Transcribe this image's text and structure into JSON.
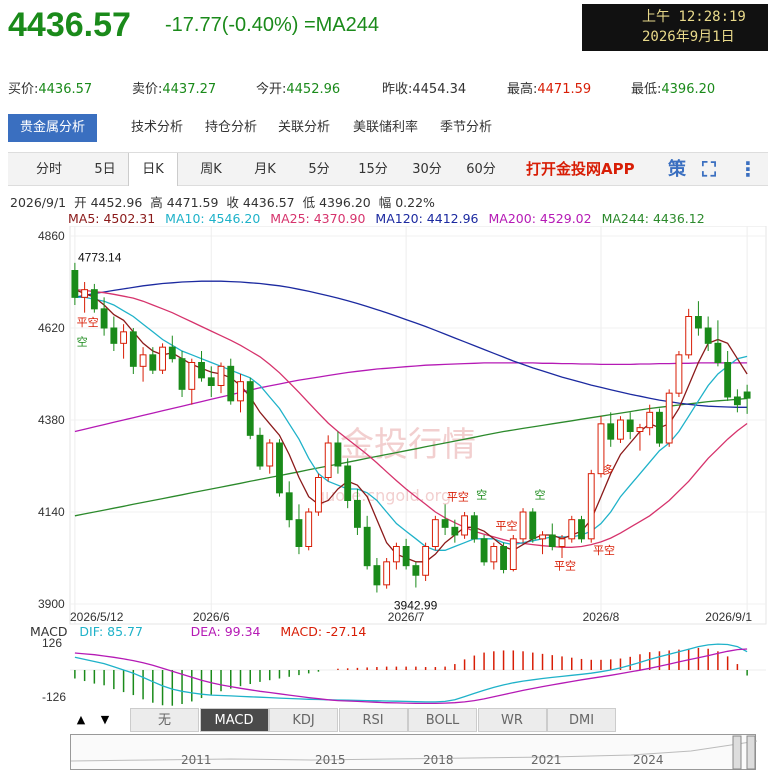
{
  "header": {
    "price": "4436.57",
    "change": "-17.77(-0.40%)",
    "indicator": "=MA244",
    "clock_line1": "上午 12:28:19",
    "clock_line2": "2026年9月1日"
  },
  "quotes": [
    {
      "label": "买价:",
      "value": "4436.57",
      "color": "g"
    },
    {
      "label": "卖价:",
      "value": "4437.27",
      "color": "g"
    },
    {
      "label": "今开:",
      "value": "4452.96",
      "color": "g"
    },
    {
      "label": "昨收:",
      "value": "4454.34",
      "color": "k"
    },
    {
      "label": "最高:",
      "value": "4471.59",
      "color": "r"
    },
    {
      "label": "最低:",
      "value": "4396.20",
      "color": "g"
    }
  ],
  "analysis_tabs": [
    "贵金属分析",
    "技术分析",
    "持仓分析",
    "关联分析",
    "美联储利率",
    "季节分析"
  ],
  "period_tabs": [
    "分时",
    "5日",
    "日K",
    "周K",
    "月K",
    "5分",
    "15分",
    "30分",
    "60分"
  ],
  "period_active": 2,
  "app_link": "打开金投网APP",
  "icons": {
    "strategy": "策",
    "fullscreen": "⛶",
    "more": "⋮"
  },
  "ohlc": {
    "date": "2026/9/1",
    "open_label": "开",
    "open": "4452.96",
    "high_label": "高",
    "high": "4471.59",
    "close_label": "收",
    "close": "4436.57",
    "low_label": "低",
    "low": "4396.20",
    "amp_label": "幅",
    "amp": "0.22%"
  },
  "ma_legend": [
    {
      "text": "MA5: 4502.31",
      "color": "#8b1a1a"
    },
    {
      "text": "MA10: 4546.20",
      "color": "#1fb2c9"
    },
    {
      "text": "MA25: 4370.90",
      "color": "#d6336c"
    },
    {
      "text": "MA120: 4412.96",
      "color": "#1c2aa0"
    },
    {
      "text": "MA200: 4529.02",
      "color": "#b51ab5"
    },
    {
      "text": "MA244: 4436.12",
      "color": "#2c8a2c"
    }
  ],
  "colors": {
    "up": "#d81e06",
    "down": "#1a8a1a",
    "accent": "#3a6fc0"
  },
  "chart_data": {
    "type": "candlestick",
    "y_ticks": [
      "4860",
      "4620",
      "4380",
      "4140",
      "3900"
    ],
    "x_ticks": [
      "2026/5/12",
      "2026/6",
      "2026/7",
      "2026/8",
      "2026/9/1"
    ],
    "ylim": [
      3900,
      4860
    ],
    "annotations": {
      "max": "4773.14",
      "min": "3942.99",
      "watermark": "金投行情",
      "watermark_url": "quote.cngold.org"
    },
    "signals": [
      "平空",
      "空",
      "平空",
      "空",
      "平空",
      "多",
      "平空",
      "空",
      "平空"
    ],
    "candles": [
      [
        4770,
        4790,
        4680,
        4700
      ],
      [
        4700,
        4740,
        4660,
        4720
      ],
      [
        4720,
        4735,
        4660,
        4670
      ],
      [
        4670,
        4700,
        4600,
        4620
      ],
      [
        4620,
        4650,
        4560,
        4580
      ],
      [
        4580,
        4630,
        4540,
        4610
      ],
      [
        4610,
        4620,
        4500,
        4520
      ],
      [
        4520,
        4570,
        4480,
        4550
      ],
      [
        4550,
        4570,
        4500,
        4510
      ],
      [
        4510,
        4580,
        4500,
        4570
      ],
      [
        4570,
        4600,
        4530,
        4540
      ],
      [
        4540,
        4560,
        4440,
        4460
      ],
      [
        4460,
        4540,
        4420,
        4530
      ],
      [
        4530,
        4560,
        4480,
        4490
      ],
      [
        4490,
        4520,
        4440,
        4470
      ],
      [
        4470,
        4530,
        4450,
        4520
      ],
      [
        4520,
        4540,
        4420,
        4430
      ],
      [
        4430,
        4500,
        4400,
        4480
      ],
      [
        4480,
        4490,
        4330,
        4340
      ],
      [
        4340,
        4360,
        4250,
        4260
      ],
      [
        4260,
        4330,
        4240,
        4320
      ],
      [
        4320,
        4330,
        4180,
        4190
      ],
      [
        4190,
        4220,
        4100,
        4120
      ],
      [
        4120,
        4160,
        4030,
        4050
      ],
      [
        4050,
        4150,
        4040,
        4140
      ],
      [
        4140,
        4240,
        4130,
        4230
      ],
      [
        4230,
        4340,
        4220,
        4320
      ],
      [
        4320,
        4350,
        4240,
        4260
      ],
      [
        4260,
        4280,
        4150,
        4170
      ],
      [
        4170,
        4200,
        4080,
        4100
      ],
      [
        4100,
        4130,
        3990,
        4000
      ],
      [
        4000,
        4020,
        3930,
        3950
      ],
      [
        3950,
        4020,
        3940,
        4010
      ],
      [
        4010,
        4060,
        3990,
        4050
      ],
      [
        4050,
        4070,
        3990,
        4000
      ],
      [
        4000,
        4010,
        3943,
        3975
      ],
      [
        3975,
        4060,
        3960,
        4050
      ],
      [
        4050,
        4130,
        4040,
        4120
      ],
      [
        4120,
        4160,
        4080,
        4100
      ],
      [
        4100,
        4120,
        4060,
        4080
      ],
      [
        4080,
        4140,
        4070,
        4130
      ],
      [
        4130,
        4140,
        4060,
        4070
      ],
      [
        4070,
        4080,
        4000,
        4010
      ],
      [
        4010,
        4060,
        3990,
        4050
      ],
      [
        4050,
        4060,
        3980,
        3990
      ],
      [
        3990,
        4080,
        3985,
        4070
      ],
      [
        4070,
        4150,
        4060,
        4140
      ],
      [
        4140,
        4150,
        4060,
        4070
      ],
      [
        4070,
        4090,
        4030,
        4080
      ],
      [
        4080,
        4110,
        4040,
        4050
      ],
      [
        4050,
        4080,
        4020,
        4070
      ],
      [
        4070,
        4130,
        4060,
        4120
      ],
      [
        4120,
        4130,
        4060,
        4070
      ],
      [
        4070,
        4250,
        4060,
        4240
      ],
      [
        4240,
        4390,
        4230,
        4370
      ],
      [
        4370,
        4400,
        4310,
        4330
      ],
      [
        4330,
        4390,
        4320,
        4380
      ],
      [
        4380,
        4400,
        4330,
        4350
      ],
      [
        4350,
        4370,
        4300,
        4360
      ],
      [
        4360,
        4420,
        4340,
        4400
      ],
      [
        4400,
        4410,
        4310,
        4320
      ],
      [
        4320,
        4460,
        4310,
        4450
      ],
      [
        4450,
        4560,
        4440,
        4550
      ],
      [
        4550,
        4670,
        4540,
        4650
      ],
      [
        4650,
        4690,
        4600,
        4620
      ],
      [
        4620,
        4650,
        4560,
        4580
      ],
      [
        4580,
        4640,
        4520,
        4530
      ],
      [
        4530,
        4560,
        4430,
        4440
      ],
      [
        4440,
        4460,
        4400,
        4420
      ],
      [
        4453,
        4472,
        4396,
        4437
      ]
    ],
    "ma5": [
      4720,
      4710,
      4700,
      4680,
      4655,
      4640,
      4610,
      4580,
      4560,
      4550,
      4555,
      4540,
      4525,
      4515,
      4505,
      4500,
      4490,
      4470,
      4440,
      4400,
      4370,
      4340,
      4290,
      4230,
      4180,
      4160,
      4170,
      4200,
      4220,
      4210,
      4180,
      4120,
      4060,
      4030,
      4020,
      4010,
      4010,
      4030,
      4060,
      4080,
      4100,
      4100,
      4090,
      4070,
      4050,
      4040,
      4055,
      4070,
      4080,
      4080,
      4070,
      4080,
      4090,
      4120,
      4180,
      4240,
      4290,
      4320,
      4350,
      4370,
      4360,
      4370,
      4410,
      4470,
      4530,
      4580,
      4590,
      4580,
      4540,
      4500
    ],
    "ma10": [
      4700,
      4700,
      4695,
      4690,
      4680,
      4665,
      4650,
      4630,
      4610,
      4590,
      4575,
      4560,
      4550,
      4540,
      4530,
      4520,
      4510,
      4500,
      4490,
      4470,
      4440,
      4410,
      4370,
      4330,
      4280,
      4240,
      4220,
      4210,
      4200,
      4200,
      4190,
      4170,
      4140,
      4110,
      4090,
      4070,
      4050,
      4040,
      4040,
      4050,
      4060,
      4070,
      4070,
      4070,
      4060,
      4055,
      4060,
      4065,
      4070,
      4075,
      4075,
      4075,
      4080,
      4090,
      4110,
      4140,
      4180,
      4210,
      4240,
      4270,
      4300,
      4320,
      4350,
      4390,
      4430,
      4470,
      4500,
      4520,
      4540,
      4546
    ],
    "ma25": [
      4720,
      4718,
      4715,
      4712,
      4708,
      4703,
      4698,
      4690,
      4680,
      4670,
      4660,
      4648,
      4636,
      4624,
      4612,
      4600,
      4588,
      4575,
      4560,
      4545,
      4525,
      4503,
      4478,
      4452,
      4425,
      4398,
      4372,
      4350,
      4330,
      4310,
      4290,
      4268,
      4245,
      4222,
      4200,
      4180,
      4160,
      4140,
      4125,
      4112,
      4100,
      4090,
      4082,
      4075,
      4068,
      4062,
      4058,
      4055,
      4052,
      4050,
      4048,
      4048,
      4050,
      4055,
      4062,
      4072,
      4085,
      4100,
      4115,
      4130,
      4150,
      4170,
      4195,
      4220,
      4250,
      4280,
      4305,
      4330,
      4352,
      4371
    ],
    "ma120": [
      4700,
      4705,
      4710,
      4714,
      4718,
      4722,
      4726,
      4730,
      4733,
      4736,
      4738,
      4740,
      4741,
      4742,
      4742,
      4742,
      4741,
      4740,
      4738,
      4736,
      4733,
      4730,
      4726,
      4721,
      4716,
      4710,
      4704,
      4698,
      4691,
      4684,
      4676,
      4668,
      4660,
      4651,
      4642,
      4633,
      4624,
      4614,
      4604,
      4594,
      4584,
      4574,
      4564,
      4554,
      4544,
      4534,
      4525,
      4516,
      4508,
      4500,
      4492,
      4485,
      4478,
      4471,
      4465,
      4459,
      4453,
      4447,
      4442,
      4437,
      4432,
      4428,
      4424,
      4421,
      4418,
      4416,
      4415,
      4414,
      4413,
      4413
    ],
    "ma200": [
      4350,
      4356,
      4362,
      4368,
      4374,
      4380,
      4386,
      4392,
      4398,
      4404,
      4410,
      4416,
      4422,
      4428,
      4434,
      4440,
      4446,
      4452,
      4458,
      4464,
      4469,
      4474,
      4479,
      4484,
      4488,
      4492,
      4496,
      4500,
      4504,
      4507,
      4510,
      4513,
      4515,
      4517,
      4519,
      4521,
      4523,
      4524,
      4525,
      4526,
      4527,
      4528,
      4529,
      4529,
      4529,
      4529,
      4529,
      4529,
      4528,
      4528,
      4527,
      4527,
      4526,
      4526,
      4525,
      4525,
      4525,
      4525,
      4526,
      4526,
      4527,
      4527,
      4528,
      4528,
      4529,
      4529,
      4529,
      4529,
      4529,
      4529
    ],
    "ma244": [
      4130,
      4135,
      4140,
      4145,
      4150,
      4155,
      4160,
      4165,
      4170,
      4175,
      4180,
      4185,
      4190,
      4195,
      4200,
      4205,
      4210,
      4215,
      4220,
      4225,
      4230,
      4235,
      4240,
      4245,
      4250,
      4255,
      4260,
      4265,
      4270,
      4275,
      4280,
      4285,
      4290,
      4295,
      4300,
      4305,
      4310,
      4315,
      4320,
      4325,
      4330,
      4335,
      4340,
      4345,
      4350,
      4354,
      4358,
      4362,
      4366,
      4370,
      4374,
      4378,
      4382,
      4386,
      4390,
      4394,
      4398,
      4402,
      4406,
      4410,
      4413,
      4416,
      4419,
      4422,
      4425,
      4428,
      4430,
      4432,
      4434,
      4436
    ],
    "macd": {
      "dif": "85.77",
      "dea": "99.34",
      "macd": "-27.14",
      "dif_label": "DIF:",
      "dea_label": "DEA:",
      "macd_label": "MACD:",
      "title": "MACD",
      "y_ticks": [
        "126",
        "-126"
      ],
      "dif_series": [
        60,
        50,
        40,
        30,
        15,
        0,
        -15,
        -35,
        -55,
        -75,
        -90,
        -100,
        -108,
        -114,
        -118,
        -120,
        -122,
        -124,
        -126,
        -128,
        -130,
        -132,
        -134,
        -136,
        -138,
        -139,
        -140,
        -141,
        -142,
        -143,
        -144,
        -145,
        -146,
        -147,
        -148,
        -149,
        -150,
        -150,
        -148,
        -140,
        -125,
        -110,
        -95,
        -82,
        -70,
        -60,
        -52,
        -46,
        -40,
        -35,
        -30,
        -25,
        -20,
        -15,
        -8,
        0,
        10,
        22,
        36,
        50,
        62,
        74,
        86,
        98,
        110,
        118,
        122,
        120,
        110,
        86
      ],
      "dea_series": [
        80,
        76,
        72,
        66,
        60,
        52,
        44,
        34,
        22,
        8,
        -6,
        -20,
        -34,
        -48,
        -60,
        -70,
        -78,
        -86,
        -93,
        -100,
        -106,
        -112,
        -118,
        -124,
        -130,
        -135,
        -140,
        -144,
        -146,
        -148,
        -150,
        -152,
        -154,
        -155,
        -156,
        -157,
        -157,
        -157,
        -156,
        -154,
        -150,
        -144,
        -136,
        -126,
        -116,
        -106,
        -96,
        -87,
        -78,
        -70,
        -62,
        -54,
        -46,
        -39,
        -32,
        -25,
        -17,
        -9,
        -1,
        8,
        18,
        28,
        38,
        48,
        58,
        68,
        78,
        88,
        96,
        99
      ]
    }
  },
  "indicator_tabs": [
    "无",
    "MACD",
    "KDJ",
    "RSI",
    "BOLL",
    "WR",
    "DMI"
  ],
  "indicator_active": 1,
  "navigator_years": [
    "2011",
    "2015",
    "2018",
    "2021",
    "2024"
  ]
}
